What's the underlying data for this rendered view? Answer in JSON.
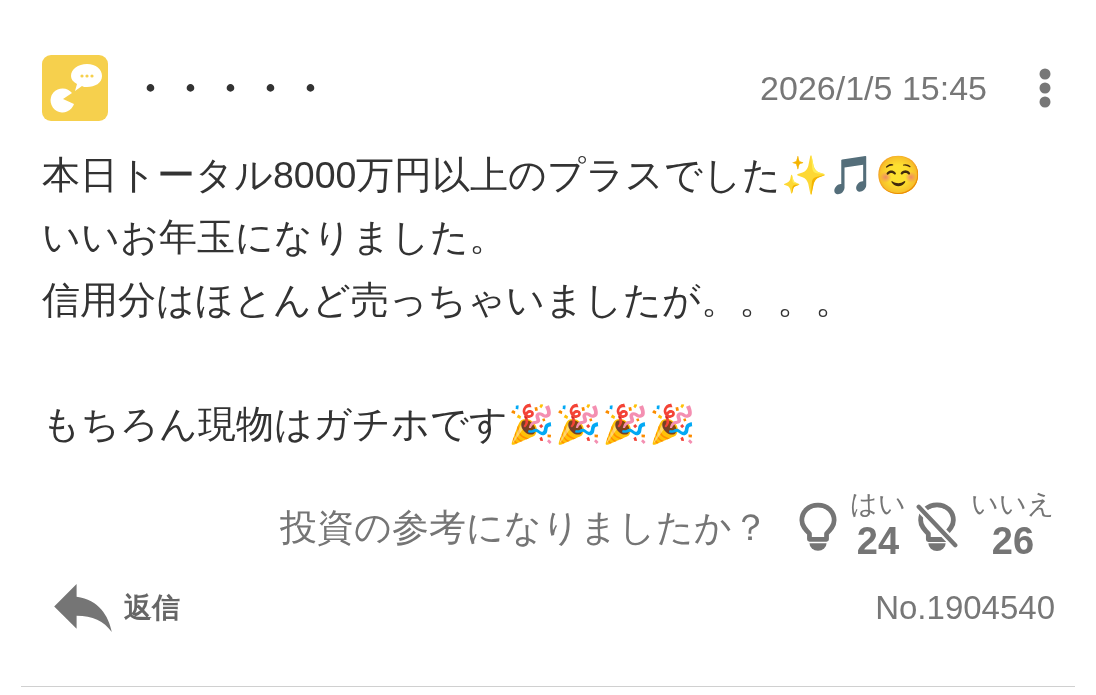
{
  "post": {
    "author": {
      "name": "・・・・・"
    },
    "timestamp": "2026/1/5 15:45",
    "body": {
      "paragraphs": [
        [
          {
            "text": "本日トータル8000万円以上のプラスでした✨🎵☺️"
          },
          {
            "text": "いいお年玉になりました。"
          },
          {
            "text": "信用分はほとんど売っちゃいましたが。。。。"
          }
        ],
        [
          {
            "text": "もちろん現物はガチホです🎉🎉🎉🎉"
          }
        ]
      ]
    },
    "feedback": {
      "question": "投資の参考になりましたか？",
      "votes": [
        {
          "kind": "helpful",
          "label": "はい",
          "count": "24"
        },
        {
          "kind": "not_helpful",
          "label": "いいえ",
          "count": "26"
        }
      ]
    },
    "reply": {
      "label": "返信"
    },
    "post_number": "No.1904540"
  }
}
